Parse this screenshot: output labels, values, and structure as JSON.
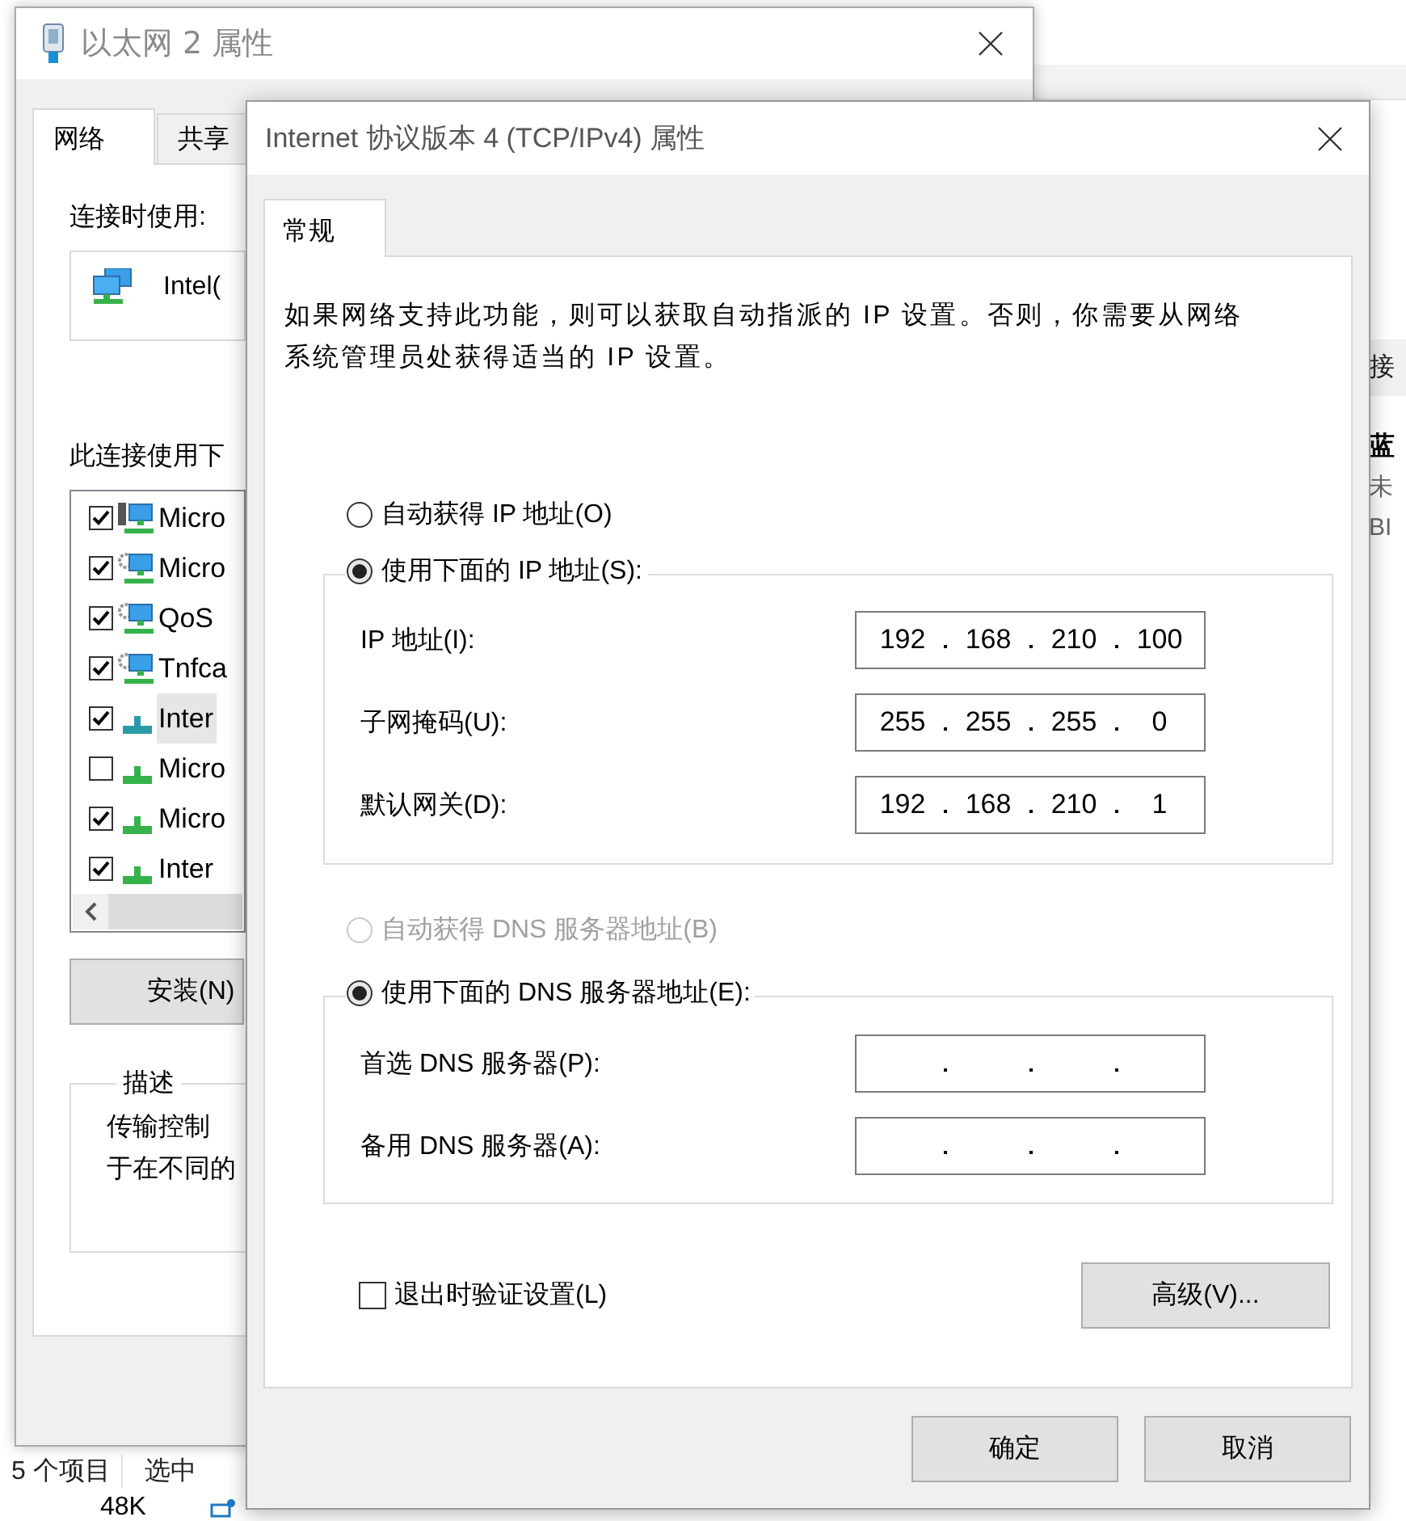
{
  "explorer": {
    "details": [
      {
        "text": "接",
        "kind": "header"
      },
      {
        "text": "蓝",
        "kind": "title"
      },
      {
        "text": "未",
        "kind": "sub"
      },
      {
        "text": "BI",
        "kind": "sub"
      }
    ],
    "status_bar": [
      "5 个项目",
      "选中"
    ],
    "size_text": "48K"
  },
  "back_window": {
    "title": "以太网 2 属性",
    "tabs": [
      {
        "label": "网络",
        "selected": true
      },
      {
        "label": "共享",
        "selected": false
      }
    ],
    "connect_using_label": "连接时使用:",
    "adapter": "Intel(",
    "items_label": "此连接使用下",
    "items": [
      {
        "label": "Micro",
        "checked": true,
        "selected": false,
        "kind": "client"
      },
      {
        "label": "Micro",
        "checked": true,
        "selected": false,
        "kind": "service"
      },
      {
        "label": "QoS",
        "checked": true,
        "selected": false,
        "kind": "service"
      },
      {
        "label": "Tnfca",
        "checked": true,
        "selected": false,
        "kind": "service"
      },
      {
        "label": "Inter",
        "checked": true,
        "selected": true,
        "kind": "protocol"
      },
      {
        "label": "Micro",
        "checked": false,
        "selected": false,
        "kind": "protocol"
      },
      {
        "label": "Micro",
        "checked": true,
        "selected": false,
        "kind": "protocol"
      },
      {
        "label": "Inter",
        "checked": true,
        "selected": false,
        "kind": "protocol"
      }
    ],
    "install_button": "安装(N)",
    "description_title": "描述",
    "description_lines": [
      "传输控制",
      "于在不同的"
    ]
  },
  "dialog": {
    "title": "Internet 协议版本 4 (TCP/IPv4) 属性",
    "tabs": [
      {
        "label": "常规",
        "selected": true
      }
    ],
    "intro": "如果网络支持此功能，则可以获取自动指派的 IP 设置。否则，你需要从网络系统管理员处获得适当的 IP 设置。",
    "ip_mode": [
      {
        "label": "自动获得 IP 地址(O)",
        "selected": false
      },
      {
        "label": "使用下面的 IP 地址(S):",
        "selected": true
      }
    ],
    "ip_fields": [
      {
        "label": "IP 地址(I):",
        "octets": [
          "192",
          "168",
          "210",
          "100"
        ]
      },
      {
        "label": "子网掩码(U):",
        "octets": [
          "255",
          "255",
          "255",
          "0"
        ]
      },
      {
        "label": "默认网关(D):",
        "octets": [
          "192",
          "168",
          "210",
          "1"
        ]
      }
    ],
    "dns_mode": [
      {
        "label": "自动获得 DNS 服务器地址(B)",
        "selected": false,
        "disabled": true
      },
      {
        "label": "使用下面的 DNS 服务器地址(E):",
        "selected": true,
        "disabled": false
      }
    ],
    "dns_fields": [
      {
        "label": "首选 DNS 服务器(P):"
      },
      {
        "label": "备用 DNS 服务器(A):"
      }
    ],
    "validate": {
      "label": "退出时验证设置(L)",
      "checked": false
    },
    "advanced_button": "高级(V)...",
    "ok_button": "确定",
    "cancel_button": "取消"
  }
}
